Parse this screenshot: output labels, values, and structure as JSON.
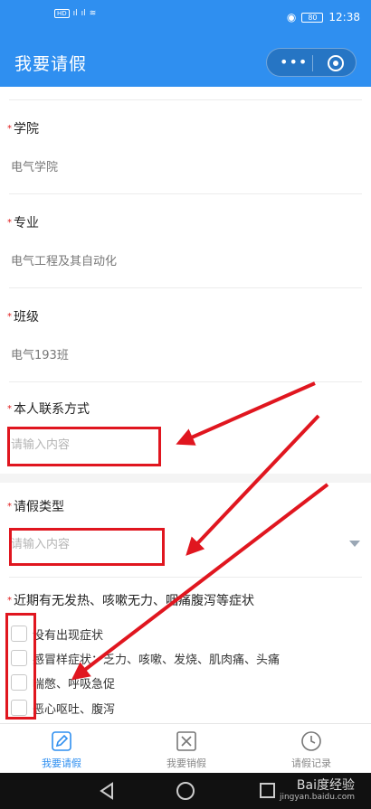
{
  "status_bar": {
    "hd1": "HD",
    "hd2": "HD",
    "battery": "80",
    "time": "12:38"
  },
  "nav": {
    "title": "我要请假",
    "more_icon": "more-dots-icon",
    "close_icon": "target-circle-icon"
  },
  "form": {
    "college": {
      "label": "学院",
      "value": "电气学院"
    },
    "major": {
      "label": "专业",
      "value": "电气工程及其自动化"
    },
    "class": {
      "label": "班级",
      "value": "电气193班"
    },
    "contact": {
      "label": "本人联系方式",
      "placeholder": "请输入内容"
    },
    "leave_type": {
      "label": "请假类型",
      "placeholder": "请输入内容"
    },
    "symptoms": {
      "label": "近期有无发热、咳嗽无力、咽痛腹泻等症状",
      "options": [
        "没有出现症状",
        "感冒样症状：乏力、咳嗽、发烧、肌肉痛、头痛",
        "喘憋、呼吸急促",
        "恶心呕吐、腹泻"
      ]
    },
    "required_mark": "*"
  },
  "tabbar": {
    "tabs": [
      {
        "label": "我要请假",
        "icon": "pencil-icon",
        "active": true
      },
      {
        "label": "我要销假",
        "icon": "cancel-box-icon",
        "active": false
      },
      {
        "label": "请假记录",
        "icon": "clock-icon",
        "active": false
      }
    ]
  },
  "watermark": {
    "brand": "Bai度经验",
    "url": "jingyan.baidu.com"
  },
  "colors": {
    "accent": "#2f8ff0",
    "annotation": "#e0161f"
  }
}
